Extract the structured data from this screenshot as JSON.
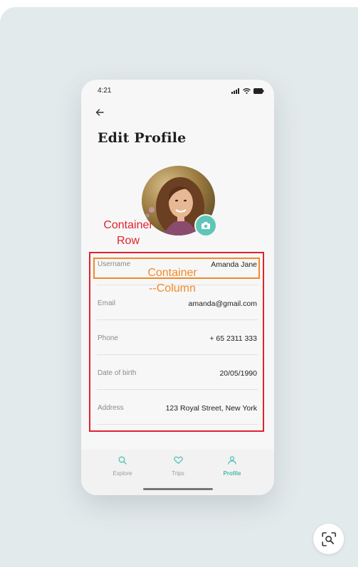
{
  "status": {
    "time": "4:21"
  },
  "header": {
    "back_icon": "arrow-left-icon",
    "title": "Edit Profile"
  },
  "profile_fields": [
    {
      "label": "Username",
      "value": "Amanda Jane"
    },
    {
      "label": "Email",
      "value": "amanda@gmail.com"
    },
    {
      "label": "Phone",
      "value": "+ 65 2311 333"
    },
    {
      "label": "Date of birth",
      "value": "20/05/1990"
    },
    {
      "label": "Address",
      "value": "123 Royal Street, New York"
    }
  ],
  "tabs": [
    {
      "label": "Explore",
      "icon": "search-icon",
      "active": false
    },
    {
      "label": "Trips",
      "icon": "heart-icon",
      "active": false
    },
    {
      "label": "Profile",
      "icon": "user-icon",
      "active": true
    }
  ],
  "annotations": {
    "row_line1": "Container",
    "row_line2": "Row",
    "column_line1": "Container",
    "column_line2": "--Column"
  },
  "colors": {
    "accent": "#5ec6b8",
    "annotation_red": "#e0232d",
    "annotation_orange": "#f2892b",
    "background": "#e3eaec"
  }
}
